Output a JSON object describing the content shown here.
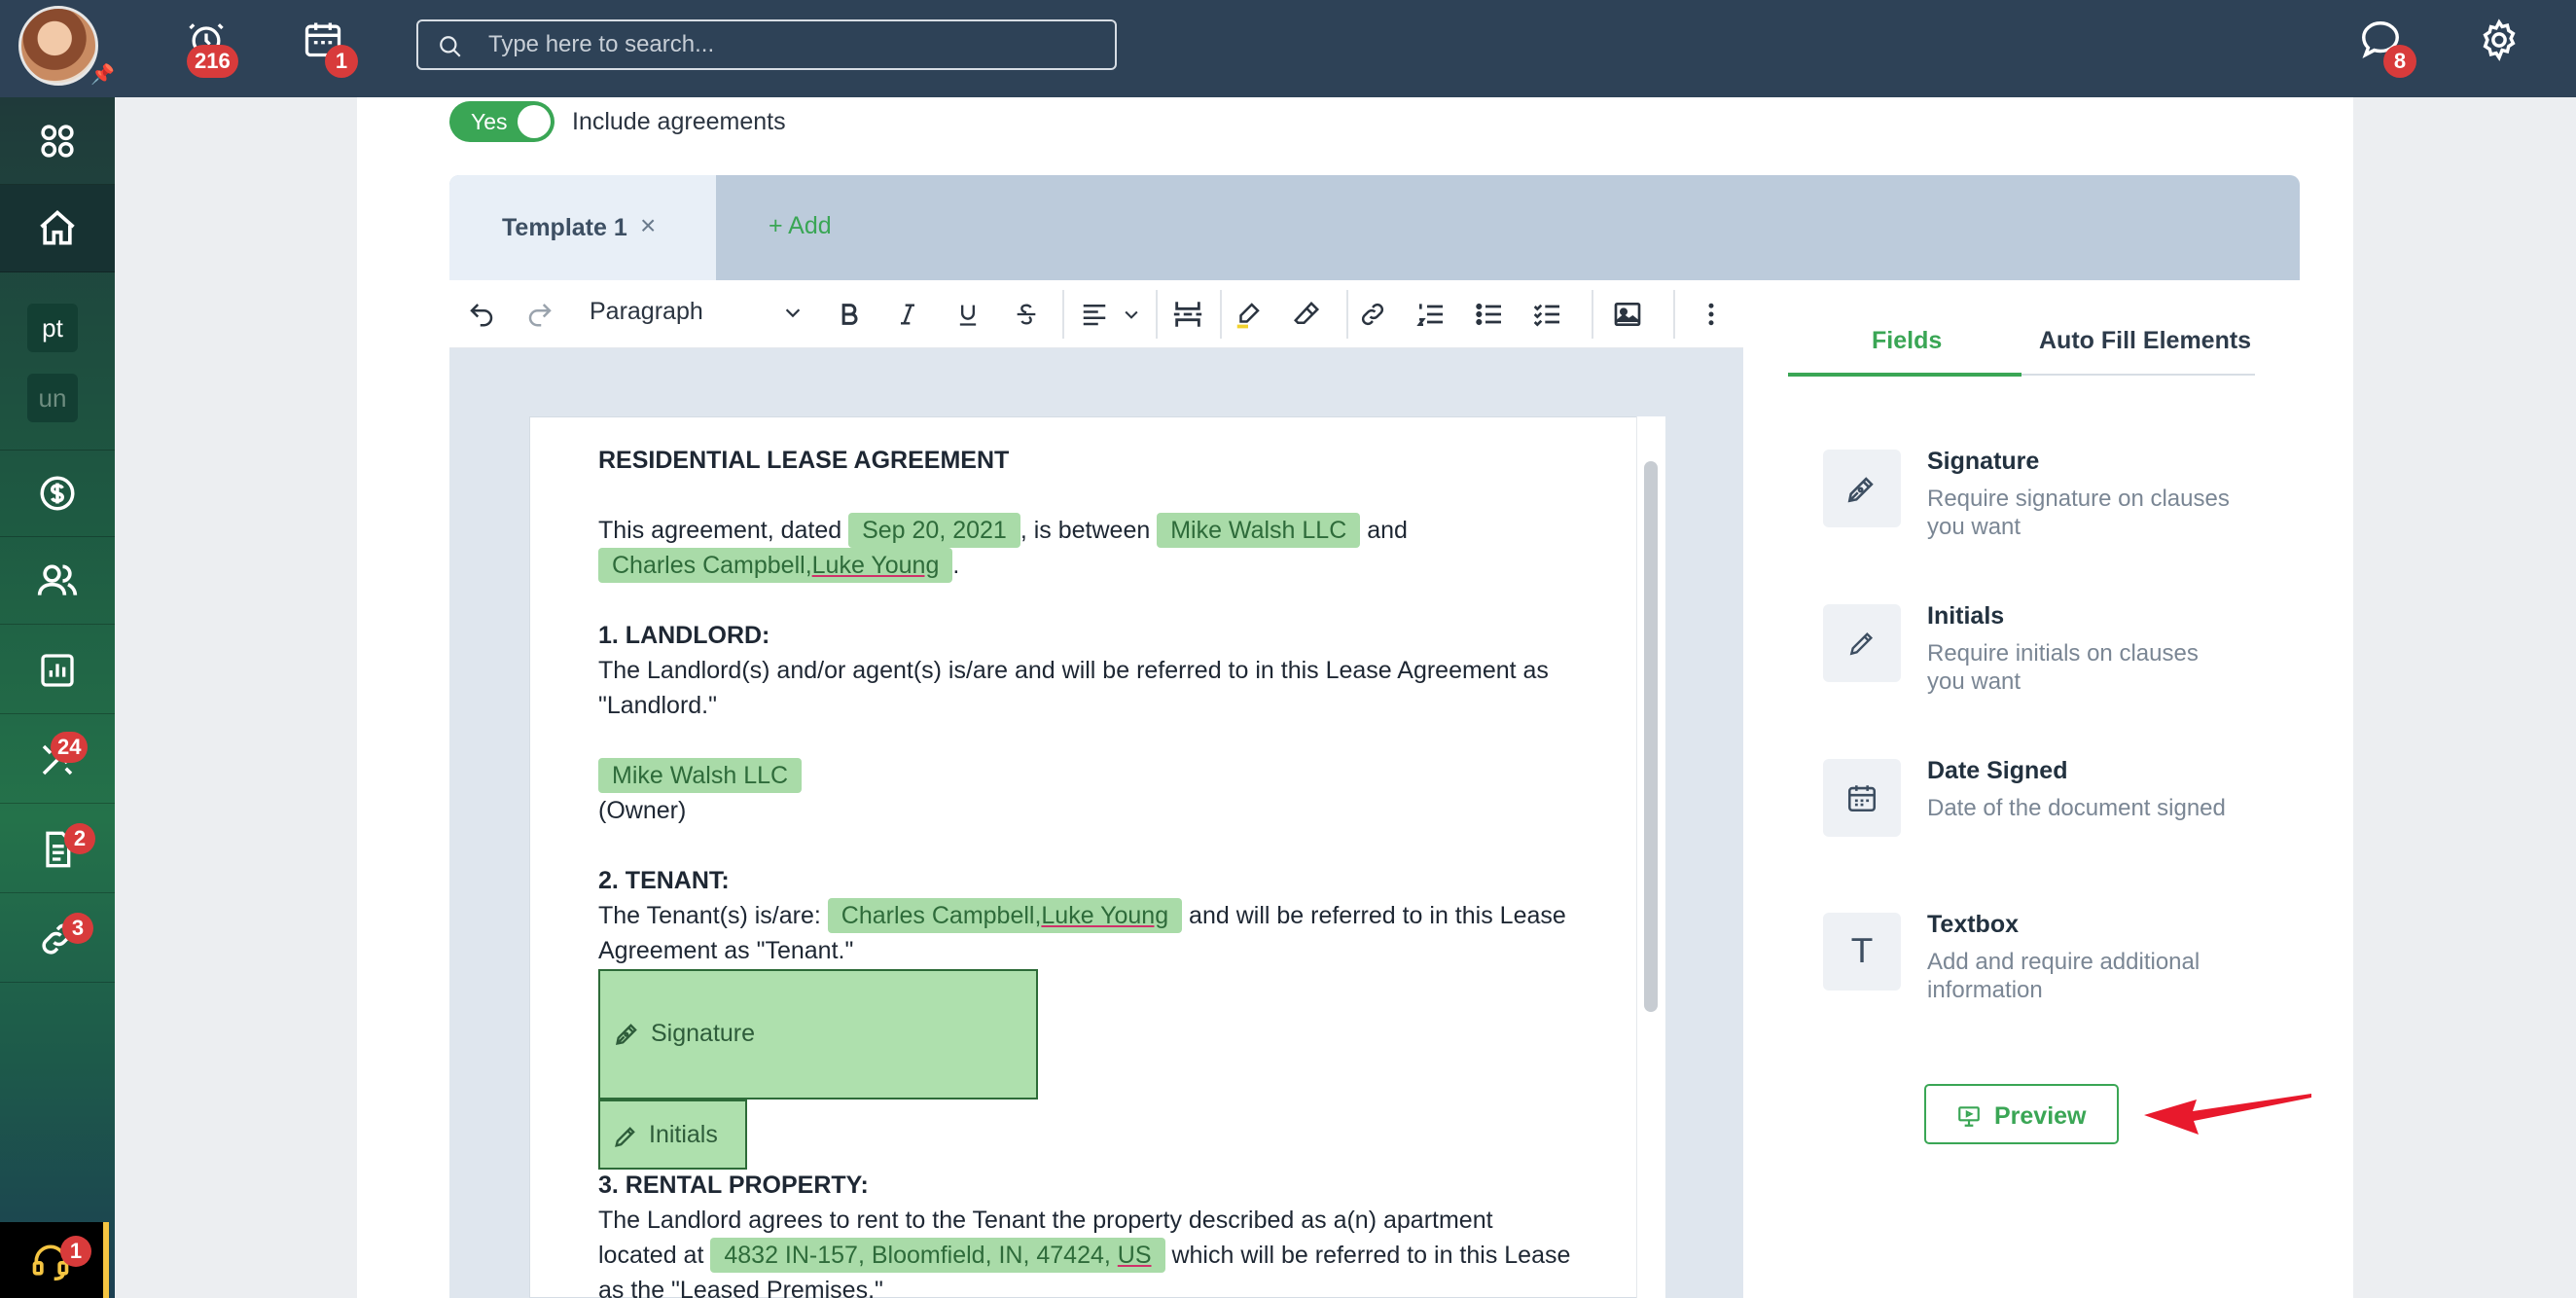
{
  "topbar": {
    "alarm_badge": "216",
    "calendar_badge": "1",
    "search_placeholder": "Type here to search...",
    "chat_badge": "8"
  },
  "sidebar": {
    "chip_pt": "pt",
    "chip_un": "un",
    "tools_badge": "24",
    "docs_badge": "2",
    "links_badge": "3",
    "support_badge": "1"
  },
  "editor": {
    "toggle_state": "Yes",
    "toggle_label": "Include agreements",
    "tab_label": "Template 1",
    "tab_close": "×",
    "add_tab": "+ Add",
    "paragraph_style": "Paragraph"
  },
  "document": {
    "title": "RESIDENTIAL LEASE AGREEMENT",
    "intro_a": "This agreement, dated ",
    "date_chip": "Sep 20, 2021",
    "intro_b": ", is between ",
    "landlord_chip": "Mike Walsh LLC",
    "intro_c": " and",
    "tenant_a": "Charles Campbell,",
    "tenant_b": "Luke Young",
    "intro_end": ".",
    "s1_heading": "1. LANDLORD:",
    "s1_line1": "The Landlord(s) and/or agent(s) is/are and will be referred to in this Lease Agreement as",
    "s1_line2": "\"Landlord.\"",
    "s1_chip": "Mike Walsh LLC",
    "s1_owner": "(Owner)",
    "s2_heading": "2. TENANT:",
    "s2_a": "The Tenant(s) is/are: ",
    "s2_b": " and will be referred to in this Lease",
    "s2_line2": "Agreement as \"Tenant.\"",
    "signature_label": "Signature",
    "initials_label": "Initials",
    "s3_heading": "3. RENTAL PROPERTY:",
    "s3_line1": "The Landlord agrees to rent to the Tenant the property described as a(n) apartment",
    "s3_a": "located at ",
    "s3_addr_a": "4832 IN-157, Bloomfield, IN, 47424, ",
    "s3_addr_b": "US",
    "s3_b": " which will be referred to in this Lease",
    "s3_line3": "as the \"Leased Premises.\""
  },
  "panel": {
    "tab_fields": "Fields",
    "tab_auto": "Auto Fill Elements",
    "fields": [
      {
        "title": "Signature",
        "desc": "Require signature on clauses you want",
        "icon": "pen-nib-icon"
      },
      {
        "title": "Initials",
        "desc": "Require initials on clauses you want",
        "icon": "pencil-icon"
      },
      {
        "title": "Date Signed",
        "desc": "Date of the document signed",
        "icon": "calendar-icon"
      },
      {
        "title": "Textbox",
        "desc": "Add and require additional information",
        "icon": "text-t-icon",
        "glyph": "T"
      }
    ],
    "preview_label": "Preview"
  },
  "colors": {
    "topbar": "#2e4257",
    "accent_green": "#3aa655",
    "chip_green": "#a9dba8",
    "badge_red": "#d83b3b",
    "annotation_arrow": "#e8192c"
  }
}
